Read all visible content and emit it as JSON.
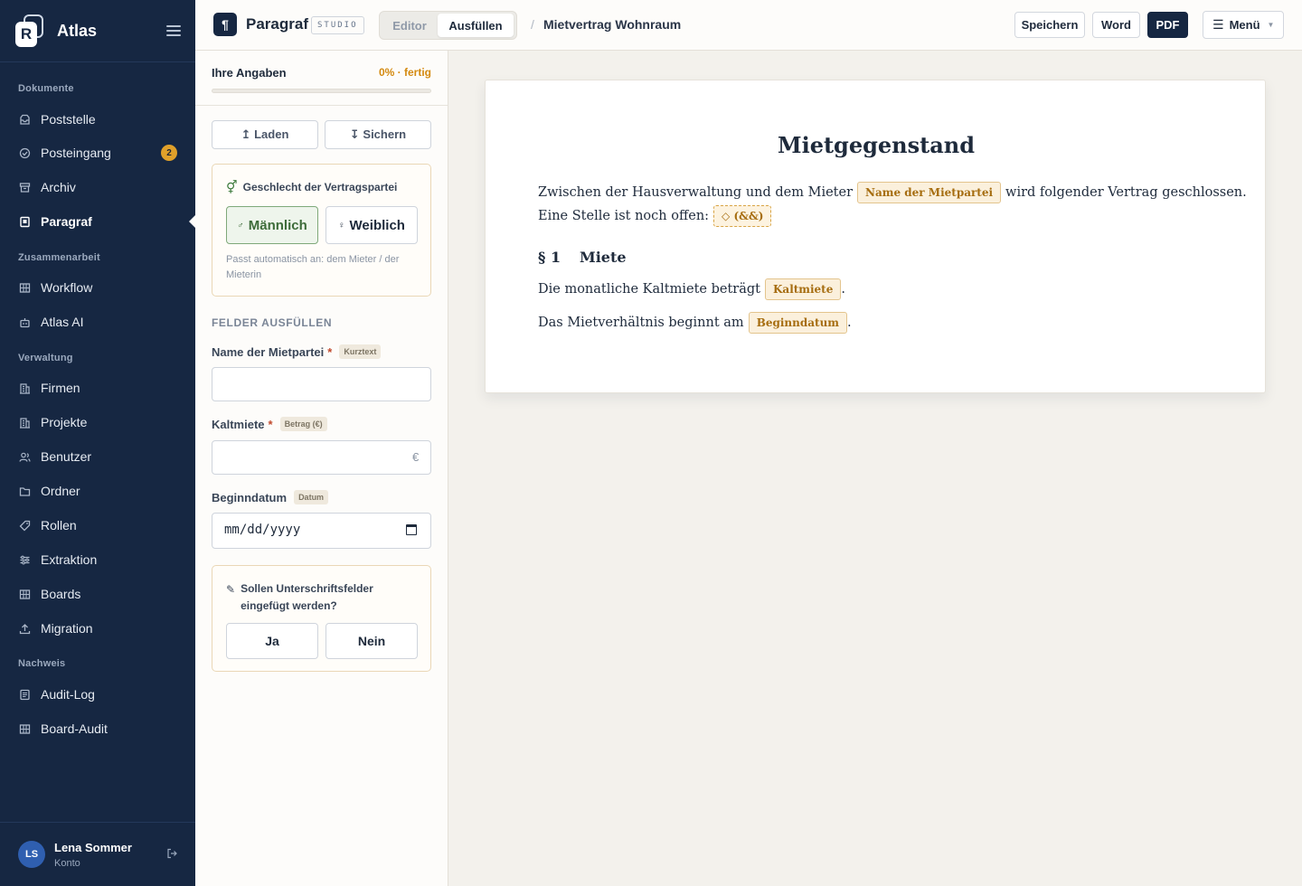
{
  "app": {
    "name": "Atlas",
    "logo_letter": "R"
  },
  "sidebar": {
    "sections": [
      {
        "label": "Dokumente"
      },
      {
        "label": "Zusammenarbeit"
      },
      {
        "label": "Verwaltung"
      },
      {
        "label": "Nachweis"
      }
    ],
    "items": [
      {
        "label": "Poststelle",
        "icon": "inbox-tray-icon"
      },
      {
        "label": "Posteingang",
        "icon": "inbox-icon",
        "badge": "2"
      },
      {
        "label": "Archiv",
        "icon": "archive-icon"
      },
      {
        "label": "Paragraf",
        "icon": "document-icon",
        "active": true
      },
      {
        "label": "Workflow",
        "icon": "grid-icon"
      },
      {
        "label": "Atlas AI",
        "icon": "robot-icon"
      },
      {
        "label": "Firmen",
        "icon": "building-icon"
      },
      {
        "label": "Projekte",
        "icon": "building-icon"
      },
      {
        "label": "Benutzer",
        "icon": "users-icon"
      },
      {
        "label": "Ordner",
        "icon": "folder-icon"
      },
      {
        "label": "Rollen",
        "icon": "tag-icon"
      },
      {
        "label": "Extraktion",
        "icon": "sliders-icon"
      },
      {
        "label": "Boards",
        "icon": "grid-icon"
      },
      {
        "label": "Migration",
        "icon": "upload-icon"
      },
      {
        "label": "Audit-Log",
        "icon": "list-icon"
      },
      {
        "label": "Board-Audit",
        "icon": "grid-icon"
      }
    ],
    "user": {
      "initials": "LS",
      "name": "Lena Sommer",
      "sub": "Konto"
    }
  },
  "topbar": {
    "title": "Paragraf",
    "studio_tag": "STUDIO",
    "modes": [
      "Editor",
      "Ausfüllen"
    ],
    "active_mode": "Ausfüllen",
    "breadcrumb_sep": "/",
    "doc_name": "Mietvertrag Wohnraum",
    "buttons": {
      "save": "Speichern",
      "word": "Word",
      "pdf": "PDF",
      "menu": "Menü"
    }
  },
  "panel": {
    "progress_label": "Ihre Angaben",
    "progress_text": "0% · fertig",
    "progress_fraction": 0,
    "load_label": "↥ Laden",
    "save_label": "↧ Sichern",
    "gender": {
      "title": "Geschlecht der Vertragspartei",
      "options": [
        {
          "symbol": "♂",
          "label": "Männlich"
        },
        {
          "symbol": "♀",
          "label": "Weiblich"
        }
      ],
      "selected": "Männlich",
      "hint": "Passt automatisch an: dem Mieter / der Mieterin"
    },
    "section_title": "FELDER AUSFÜLLEN",
    "fields": [
      {
        "label": "Name der Mietpartei",
        "required": "*",
        "type_tag": "Kurztext",
        "value": ""
      },
      {
        "label": "Kaltmiete",
        "required": "*",
        "type_tag": "Betrag (€)",
        "value": "",
        "unit": "€"
      },
      {
        "label": "Beginndatum",
        "type_tag": "Datum",
        "placeholder": "mm/dd/yyyy"
      }
    ],
    "signature": {
      "question": "Sollen Unterschriftsfelder eingefügt werden?",
      "yes": "Ja",
      "no": "Nein"
    }
  },
  "document": {
    "title": "Mietgegenstand",
    "line1": {
      "before": "Zwischen der Hausverwaltung und dem Mieter",
      "chip": "Name der Mietpartei",
      "after": "wird folgender Vertrag geschlossen."
    },
    "line2": {
      "before": "Eine Stelle ist noch offen:",
      "chip": "◇ (&&)"
    },
    "section_number": "§ 1",
    "section_title": "Miete",
    "line3": {
      "before": "Die monatliche Kaltmiete beträgt",
      "chip": "Kaltmiete",
      "after": "."
    },
    "line4": {
      "before": "Das Mietverhältnis beginnt am",
      "chip": "Beginndatum",
      "after": "."
    }
  }
}
